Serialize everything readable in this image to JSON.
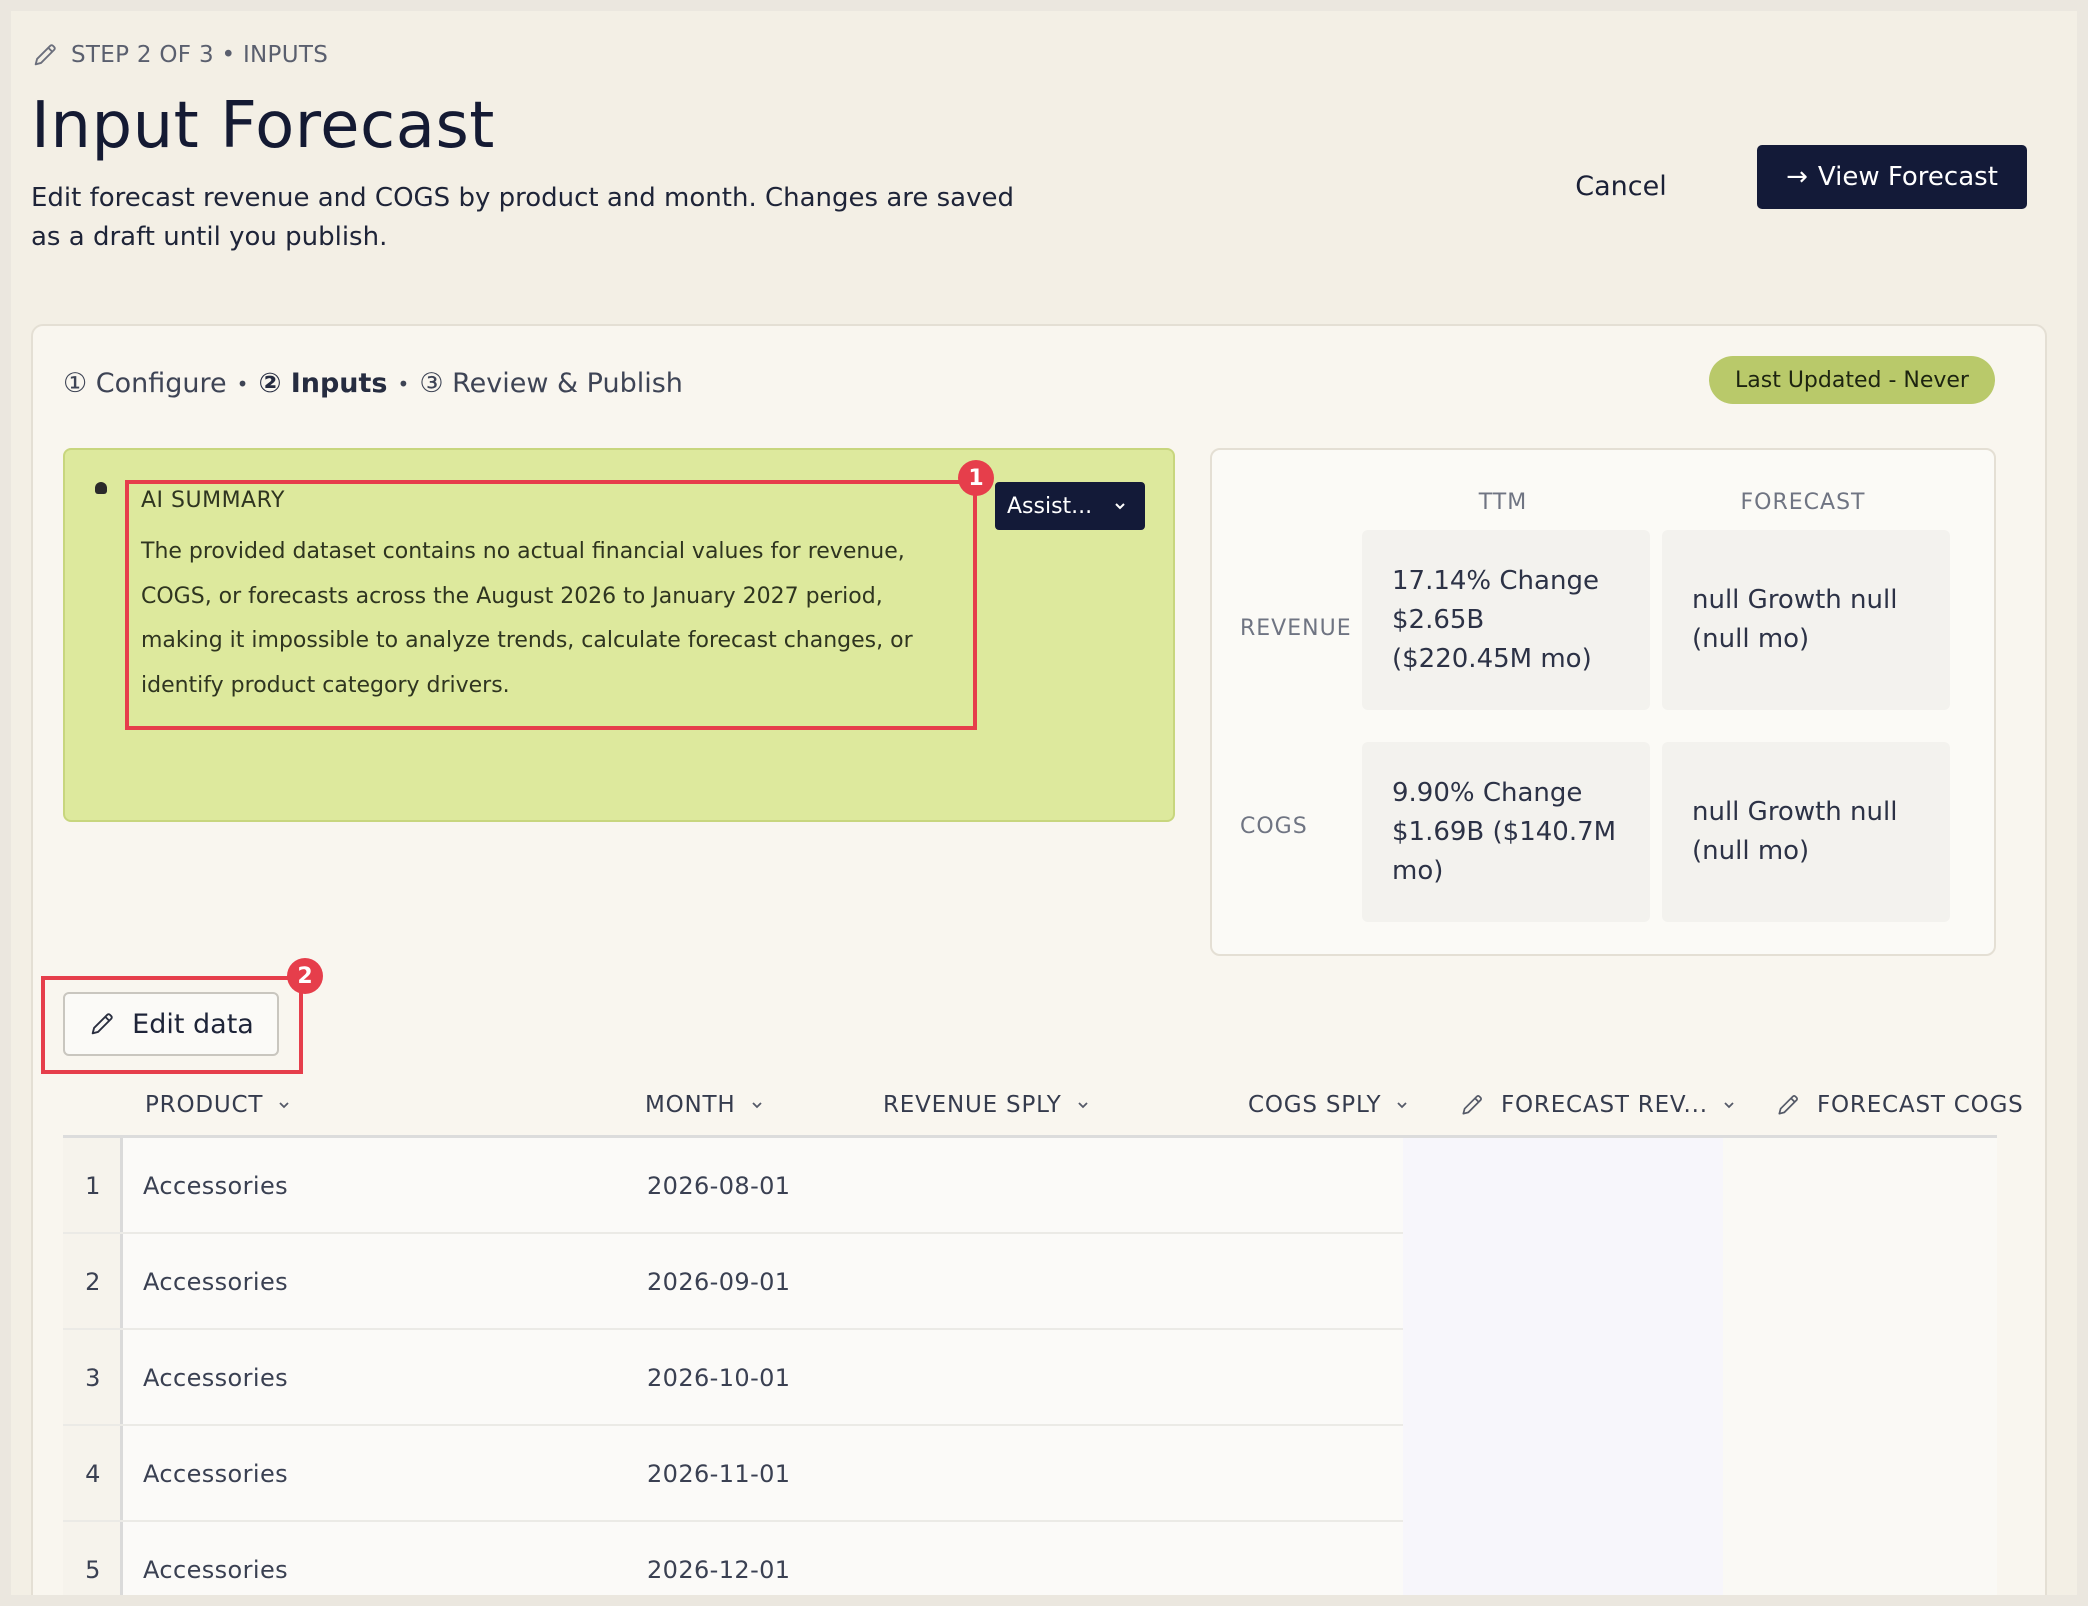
{
  "header": {
    "step_label": "STEP 2 OF 3 • INPUTS",
    "title": "Input Forecast",
    "description": "Edit forecast revenue and COGS by product and month. Changes are saved as a draft until you publish.",
    "cancel_label": "Cancel",
    "view_forecast_label": "View Forecast",
    "view_forecast_arrow": "→"
  },
  "stepper": {
    "steps": [
      {
        "label": "① Configure",
        "active": false
      },
      {
        "label": "② Inputs",
        "active": true
      },
      {
        "label": "③ Review & Publish",
        "active": false
      }
    ],
    "separator": "•"
  },
  "last_updated": "Last Updated - Never",
  "ai_summary": {
    "title": "AI SUMMARY",
    "text": "The provided dataset contains no actual financial values for revenue, COGS, or forecasts across the August 2026 to January 2027 period, making it impossible to analyze trends, calculate forecast changes, or identify product category drivers.",
    "assist_label": "Assist...",
    "marker": "1"
  },
  "metrics": {
    "columns": [
      "TTM",
      "FORECAST"
    ],
    "rows": [
      {
        "label": "REVENUE",
        "ttm": "17.14% Change $2.65B ($220.45M mo)",
        "forecast": "null Growth null (null mo)"
      },
      {
        "label": "COGS",
        "ttm": "9.90% Change $1.69B ($140.7M mo)",
        "forecast": "null Growth null (null mo)"
      }
    ]
  },
  "edit_button": {
    "label": "Edit data",
    "marker": "2"
  },
  "table": {
    "columns": [
      "PRODUCT",
      "MONTH",
      "REVENUE SPLY",
      "COGS SPLY",
      "FORECAST REV...",
      "FORECAST COGS"
    ],
    "rows": [
      {
        "index": "1",
        "product": "Accessories",
        "month": "2026-08-01"
      },
      {
        "index": "2",
        "product": "Accessories",
        "month": "2026-09-01"
      },
      {
        "index": "3",
        "product": "Accessories",
        "month": "2026-10-01"
      },
      {
        "index": "4",
        "product": "Accessories",
        "month": "2026-11-01"
      },
      {
        "index": "5",
        "product": "Accessories",
        "month": "2026-12-01"
      }
    ]
  },
  "icons": {
    "step": "pencil-icon",
    "edit": "pencil-icon",
    "sort": "chevron-down-icon"
  },
  "colors": {
    "primary": "#131a38",
    "ai_panel": "#dde99d",
    "badge": "#b9c96a",
    "highlight": "#e63e4b"
  }
}
